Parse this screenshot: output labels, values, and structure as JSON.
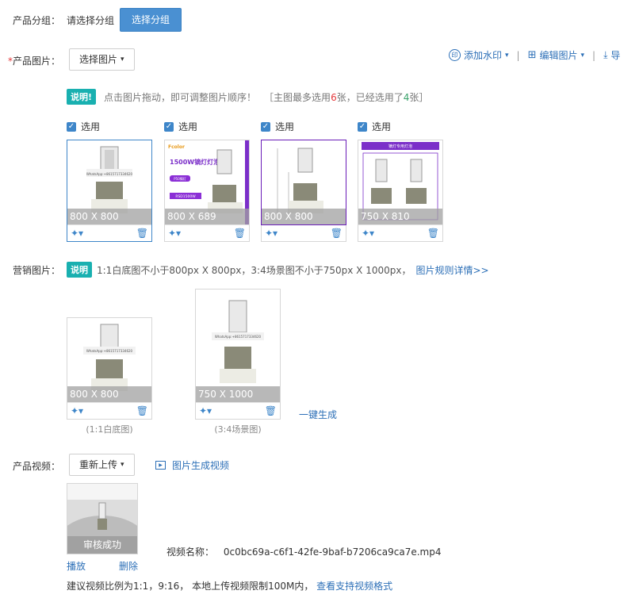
{
  "group": {
    "label": "产品分组：",
    "value": "请选择分组",
    "button": "选择分组"
  },
  "product_images": {
    "required_mark": "*",
    "label": "产品图片：",
    "select_button": "选择图片",
    "toolbar": {
      "watermark": "添加水印",
      "edit": "编辑图片",
      "export": "导"
    },
    "notice_badge": "说明!",
    "notice_text": "点击图片拖动，即可调整图片顺序！",
    "rule_prefix": "［主图最多选用",
    "rule_max": "6",
    "rule_mid": "张，已经选用了",
    "rule_used": "4",
    "rule_suffix": "张］",
    "check_label": "选用",
    "items": [
      {
        "size": "800 X 800"
      },
      {
        "size": "800 X 689",
        "promo_title": "1500W镝灯灯泡",
        "promo_tag": "P50镝灯",
        "promo_price": "RSD1500W",
        "brand": "Fcolor"
      },
      {
        "size": "800 X 800"
      },
      {
        "size": "750 X 810",
        "banner": "镝灯专用灯泡"
      }
    ],
    "watermark_text": "WhatsApp:+8615717334620"
  },
  "marketing": {
    "label": "营销图片：",
    "badge": "说明",
    "desc": "1:1白底图不小于800px X 800px，3:4场景图不小于750px X 1000px，",
    "rule_link": "图片规则详情>>",
    "items": [
      {
        "size": "800 X 800",
        "caption": "(1:1白底图)"
      },
      {
        "size": "750 X 1000",
        "caption": "(3:4场景图)"
      }
    ],
    "generate": "一键生成"
  },
  "video": {
    "label": "产品视频：",
    "reupload": "重新上传",
    "gen_link": "图片生成视频",
    "status": "审核成功",
    "play": "播放",
    "delete": "删除",
    "name_label": "视频名称：",
    "name_value": "0c0bc69a-c6f1-42fe-9baf-b7206ca9ca7e.mp4",
    "tip": "建议视频比例为1:1，9:16， 本地上传视频限制100M内，",
    "formats_link": "查看支持视频格式"
  },
  "colors": {
    "primary": "#4a90d2",
    "link": "#2c6fb7",
    "badge": "#19b0b0",
    "required": "#e4393c"
  }
}
